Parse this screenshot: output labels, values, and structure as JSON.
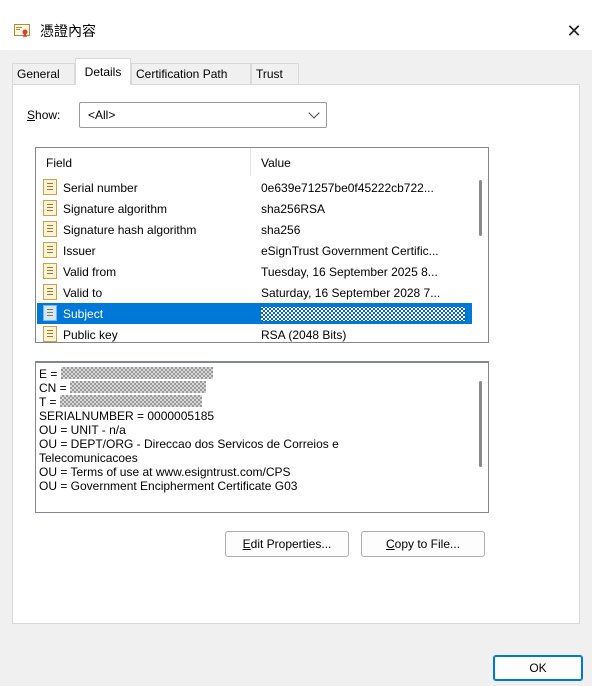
{
  "window": {
    "title": "憑證內容",
    "close_glyph": "✕"
  },
  "tabs": [
    {
      "label": "General",
      "active": false
    },
    {
      "label": "Details",
      "active": true
    },
    {
      "label": "Certification Path",
      "active": false
    },
    {
      "label": "Trust",
      "active": false
    }
  ],
  "show": {
    "label": "Show:",
    "accesskey": "S",
    "label_rest": "how:",
    "selected": "<All>"
  },
  "field_list": {
    "headers": {
      "field": "Field",
      "value": "Value"
    },
    "rows": [
      {
        "field": "Serial number",
        "value": "0e639e71257be0f45222cb722...",
        "selected": false
      },
      {
        "field": "Signature algorithm",
        "value": "sha256RSA",
        "selected": false
      },
      {
        "field": "Signature hash algorithm",
        "value": "sha256",
        "selected": false
      },
      {
        "field": "Issuer",
        "value": "eSignTrust Government Certific...",
        "selected": false
      },
      {
        "field": "Valid from",
        "value": "Tuesday, 16 September 2025 8...",
        "selected": false
      },
      {
        "field": "Valid to",
        "value": "Saturday, 16 September 2028 7...",
        "selected": false
      },
      {
        "field": "Subject",
        "value": "",
        "selected": true
      },
      {
        "field": "Public key",
        "value": "RSA (2048 Bits)",
        "selected": false
      }
    ],
    "scroll_position": 0.3
  },
  "details": {
    "lines": [
      "E = ",
      "CN = ",
      "T = ",
      "SERIALNUMBER = 0000005185",
      "OU = UNIT - n/a",
      "OU = DEPT/ORG - Direccao dos Servicos de Correios e",
      "Telecomunicacoes",
      "OU = Terms of use at www.esigntrust.com/CPS",
      "OU = Government Encipherment Certificate G03"
    ]
  },
  "buttons": {
    "edit_properties": {
      "accesskey": "E",
      "rest": "dit Properties..."
    },
    "copy_to_file": {
      "accesskey": "C",
      "rest": "opy to File..."
    },
    "ok": "OK"
  },
  "colors": {
    "selection": "#0078d7",
    "accent": "#0078d7"
  }
}
